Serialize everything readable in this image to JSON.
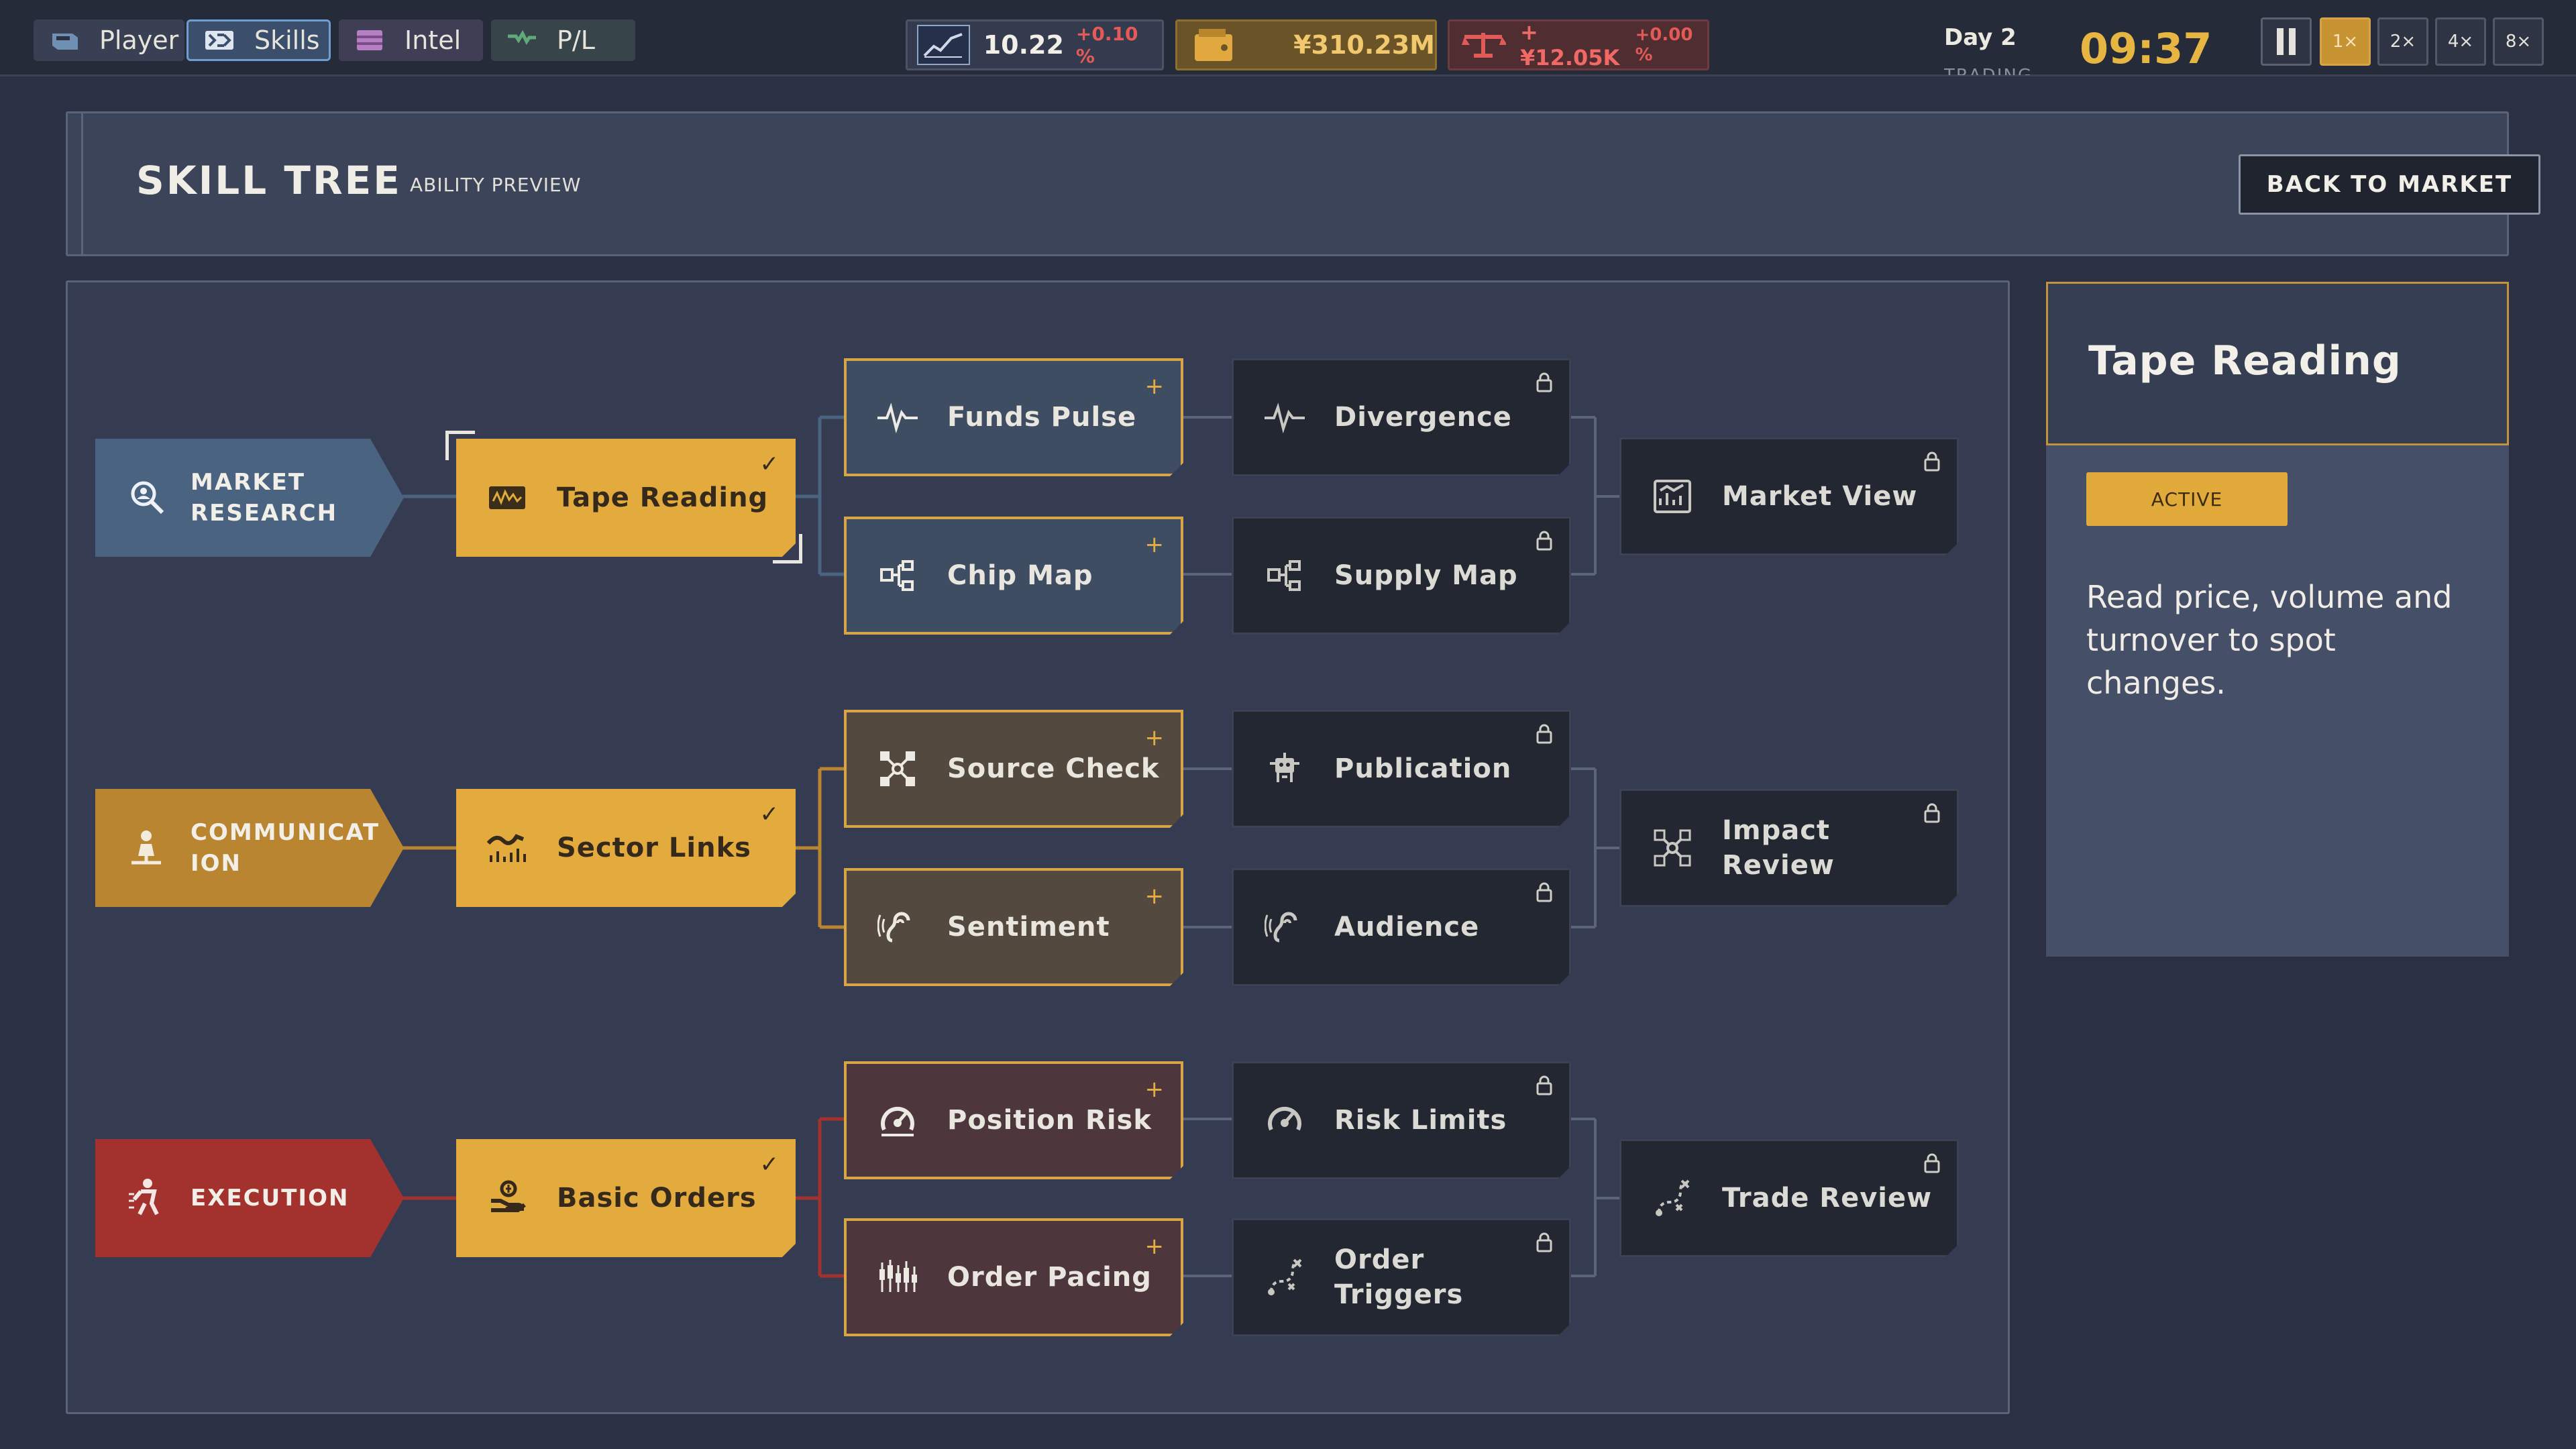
{
  "nav": {
    "tabs": [
      {
        "label": "Player",
        "icon": "controller-icon",
        "active": false
      },
      {
        "label": "Skills",
        "icon": "skill-tree-icon",
        "active": true
      },
      {
        "label": "Intel",
        "icon": "folder-icon",
        "active": false
      },
      {
        "label": "P/L",
        "icon": "cash-icon",
        "active": false
      }
    ]
  },
  "stats": {
    "index": {
      "value": "10.22",
      "change": "+0.10 %",
      "icon": "line-chart-icon"
    },
    "cash": {
      "value": "¥310.23M",
      "icon": "wallet-icon"
    },
    "pl": {
      "value": "+¥12.05K",
      "change": "+0.00 %",
      "icon": "scale-icon"
    }
  },
  "clock": {
    "day": "Day 2",
    "phase": "TRADING",
    "time": "09:37"
  },
  "speed": {
    "options": [
      "1×",
      "2×",
      "4×",
      "8×"
    ],
    "selected": "1×"
  },
  "header": {
    "title": "SKILL TREE",
    "subtitle": "ABILITY PREVIEW",
    "back_label": "BACK TO MARKET"
  },
  "colors": {
    "accent": "#e3aa3e",
    "market": "#4a6380",
    "communication": "#b98530",
    "execution": "#a3322e",
    "locked": "#222731"
  },
  "tree": {
    "market": {
      "category": "MARKET RESEARCH",
      "root": {
        "label": "Tape Reading",
        "state": "owned"
      },
      "tier2": [
        {
          "label": "Funds Pulse",
          "state": "available"
        },
        {
          "label": "Chip Map",
          "state": "available"
        }
      ],
      "tier3": [
        {
          "label": "Divergence",
          "state": "locked"
        },
        {
          "label": "Supply Map",
          "state": "locked"
        }
      ],
      "tier4": {
        "label": "Market View",
        "state": "locked"
      }
    },
    "communication": {
      "category": "COMMUNICATION",
      "root": {
        "label": "Sector Links",
        "state": "owned"
      },
      "tier2": [
        {
          "label": "Source Check",
          "state": "available"
        },
        {
          "label": "Sentiment",
          "state": "available"
        }
      ],
      "tier3": [
        {
          "label": "Publication",
          "state": "locked"
        },
        {
          "label": "Audience",
          "state": "locked"
        }
      ],
      "tier4": {
        "label": "Impact Review",
        "state": "locked"
      }
    },
    "execution": {
      "category": "EXECUTION",
      "root": {
        "label": "Basic Orders",
        "state": "owned"
      },
      "tier2": [
        {
          "label": "Position Risk",
          "state": "available"
        },
        {
          "label": "Order Pacing",
          "state": "available"
        }
      ],
      "tier3": [
        {
          "label": "Risk Limits",
          "state": "locked"
        },
        {
          "label": "Order Triggers",
          "state": "locked"
        }
      ],
      "tier4": {
        "label": "Trade Review",
        "state": "locked"
      }
    }
  },
  "detail": {
    "title": "Tape Reading",
    "status": "ACTIVE",
    "description": "Read price, volume and turnover to spot changes."
  }
}
